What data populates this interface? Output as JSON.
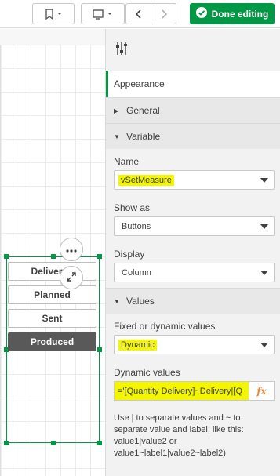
{
  "toolbar": {
    "done_label": "Done editing"
  },
  "canvas": {
    "buttons": [
      "Delivered",
      "Planned",
      "Sent",
      "Produced"
    ],
    "selected_button": "Produced"
  },
  "panel": {
    "appearance_label": "Appearance",
    "sections": {
      "general": "General",
      "variable": "Variable",
      "values": "Values"
    },
    "name_label": "Name",
    "name_value": "vSetMeasure",
    "show_as_label": "Show as",
    "show_as_value": "Buttons",
    "display_label": "Display",
    "display_value": "Column",
    "fixed_dynamic_label": "Fixed or dynamic values",
    "fixed_dynamic_value": "Dynamic",
    "dynamic_values_label": "Dynamic values",
    "dynamic_values_expr": "='[Quantity Delivery]~Delivery|[Q",
    "fx_label": "fx",
    "help_text": "Use | to separate values and ~ to separate value and label, like this: value1|value2 or value1~label1|value2~label2)"
  },
  "colors": {
    "accent": "#009845",
    "highlight": "#f4f600",
    "selected_button": "#595959"
  }
}
